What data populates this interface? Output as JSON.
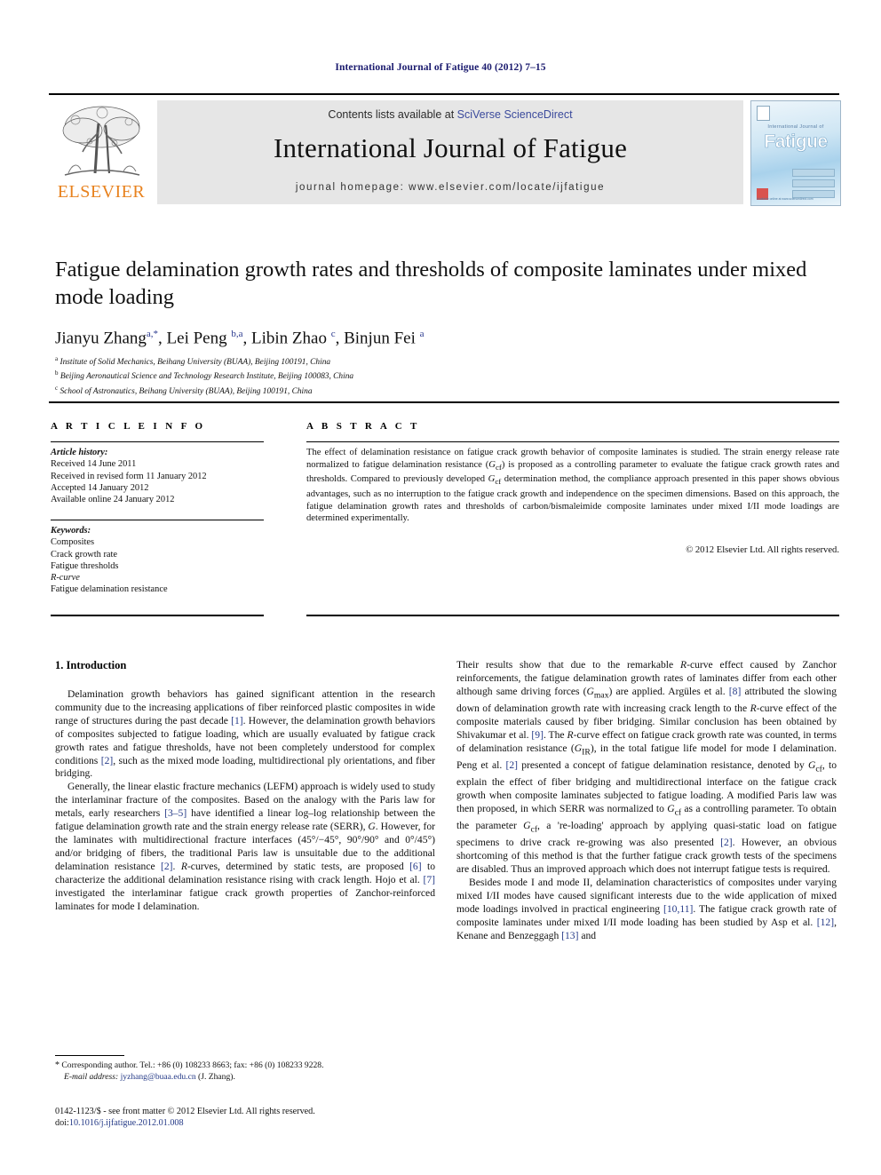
{
  "running_head": "International Journal of Fatigue 40 (2012) 7–15",
  "masthead": {
    "contents_prefix": "Contents lists available at ",
    "contents_link": "SciVerse ScienceDirect",
    "journal_title": "International Journal of Fatigue",
    "homepage": "journal homepage: www.elsevier.com/locate/ijfatigue",
    "publisher_logo_text": "ELSEVIER",
    "cover": {
      "line1": "International Journal of",
      "line2": "Fatigue",
      "footer": "Available online at www.sciencedirect.com"
    }
  },
  "article": {
    "title": "Fatigue delamination growth rates and thresholds of composite laminates under mixed mode loading",
    "affiliations": [
      {
        "marker": "a",
        "text": "Institute of Solid Mechanics, Beihang University (BUAA), Beijing 100191, China"
      },
      {
        "marker": "b",
        "text": "Beijing Aeronautical Science and Technology Research Institute, Beijing 100083, China"
      },
      {
        "marker": "c",
        "text": "School of Astronautics, Beihang University (BUAA), Beijing 100191, China"
      }
    ]
  },
  "info": {
    "heading": "A R T I C L E   I N F O",
    "history_label": "Article history:",
    "history": [
      "Received 14 June 2011",
      "Received in revised form 11 January 2012",
      "Accepted 14 January 2012",
      "Available online 24 January 2012"
    ],
    "keywords_label": "Keywords:",
    "keywords": [
      "Composites",
      "Crack growth rate",
      "Fatigue thresholds",
      "R-curve",
      "Fatigue delamination resistance"
    ]
  },
  "abstract": {
    "heading": "A B S T R A C T",
    "copyright": "© 2012 Elsevier Ltd. All rights reserved."
  },
  "body": {
    "section_title": "1. Introduction"
  },
  "footnote": {
    "corresponding": "Corresponding author. Tel.: +86 (0) 108233 8663; fax: +86 (0) 108233 9228.",
    "email_label": "E-mail address:",
    "email": "jyzhang@buaa.edu.cn",
    "email_owner": "(J. Zhang)."
  },
  "issn": {
    "line1": "0142-1123/$ - see front matter © 2012 Elsevier Ltd. All rights reserved.",
    "doi_label": "doi:",
    "doi": "10.1016/j.ijfatigue.2012.01.008"
  },
  "colors": {
    "link": "#253a87",
    "running_head": "#1a1a6e",
    "elsevier_orange": "#E8821E",
    "masthead_bg": "#e6e6e6"
  }
}
